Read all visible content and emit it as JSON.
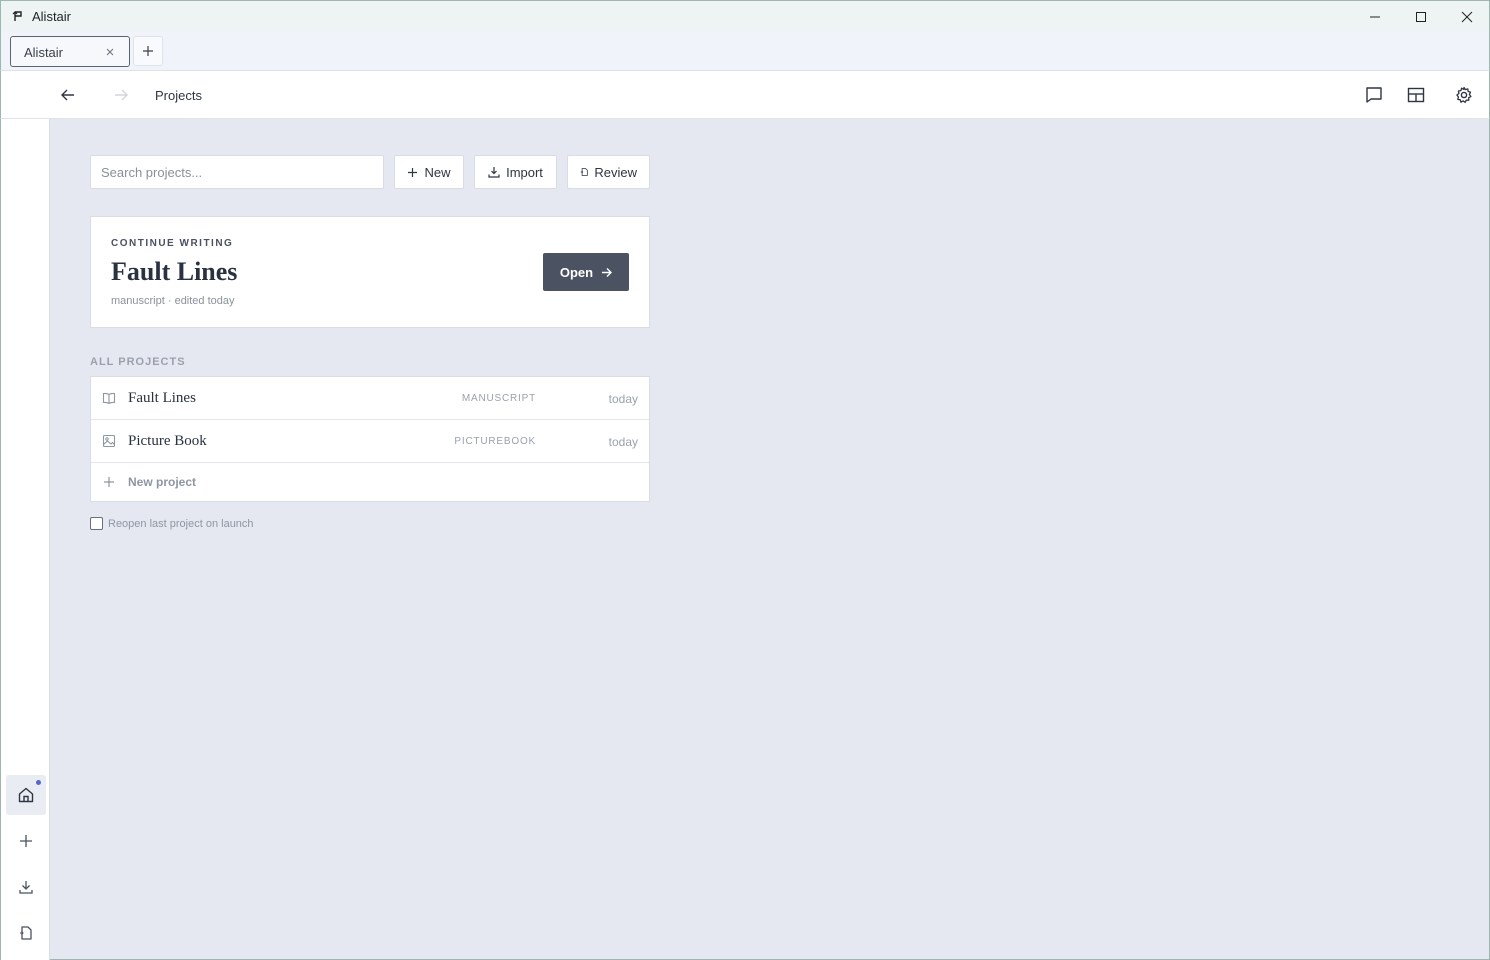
{
  "window": {
    "title": "Alistair"
  },
  "tabs": [
    {
      "label": "Alistair"
    }
  ],
  "nav": {
    "breadcrumb": "Projects"
  },
  "toolbar": {
    "search_placeholder": "Search projects...",
    "new_label": "New",
    "import_label": "Import",
    "review_label": "Review"
  },
  "continue": {
    "eyebrow": "CONTINUE WRITING",
    "title": "Fault Lines",
    "meta": "manuscript · edited today",
    "open_label": "Open"
  },
  "projects": {
    "section_label": "ALL PROJECTS",
    "items": [
      {
        "name": "Fault Lines",
        "type": "MANUSCRIPT",
        "date": "today",
        "icon": "book-icon"
      },
      {
        "name": "Picture Book",
        "type": "PICTUREBOOK",
        "date": "today",
        "icon": "image-icon"
      }
    ],
    "new_label": "New project"
  },
  "settings": {
    "reopen_label": "Reopen last project on launch",
    "reopen_checked": false
  },
  "sidebar": {
    "items": [
      {
        "icon": "home-icon",
        "active": true,
        "notification": true
      },
      {
        "icon": "plus-icon"
      },
      {
        "icon": "download-icon"
      },
      {
        "icon": "document-review-icon"
      }
    ]
  },
  "colors": {
    "accent": "#5468c9",
    "primary_button": "#4b5262",
    "background": "#e5e8f0"
  }
}
